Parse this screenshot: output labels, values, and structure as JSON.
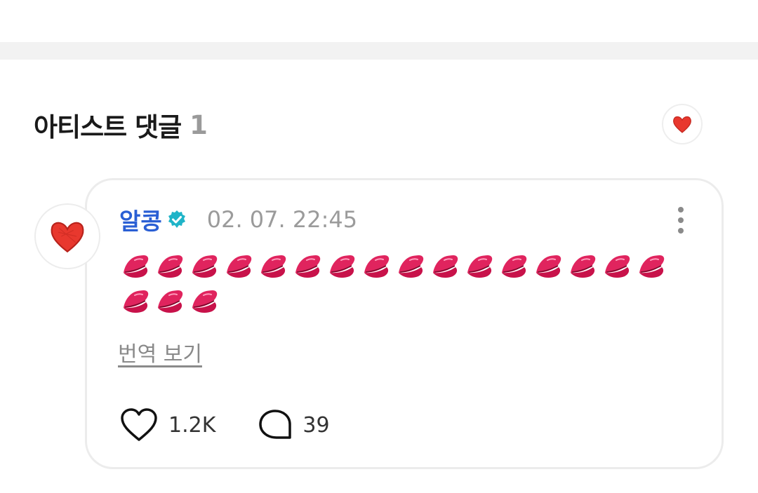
{
  "section": {
    "title": "아티스트 댓글",
    "count": "1"
  },
  "comment": {
    "author": "알콩",
    "verified": true,
    "timestamp": "02. 07. 22:45",
    "text_emoji": "💋",
    "emoji_count": 19,
    "emoji_rows": [
      16,
      3
    ],
    "translate_label": "번역 보기",
    "likes": "1.2K",
    "replies": "39"
  },
  "colors": {
    "author": "#2a5fd4",
    "verified_badge": "#1fb4c8",
    "heart_avatar": "#e8382e",
    "lips": "#e0245e",
    "muted_text": "#9b9b9b"
  },
  "icons": {
    "avatar": "red-heart-icon",
    "verified": "verified-badge-icon",
    "more": "more-vertical-icon",
    "like": "heart-outline-icon",
    "reply": "speech-bubble-icon",
    "emoji": "kiss-lips-icon"
  }
}
